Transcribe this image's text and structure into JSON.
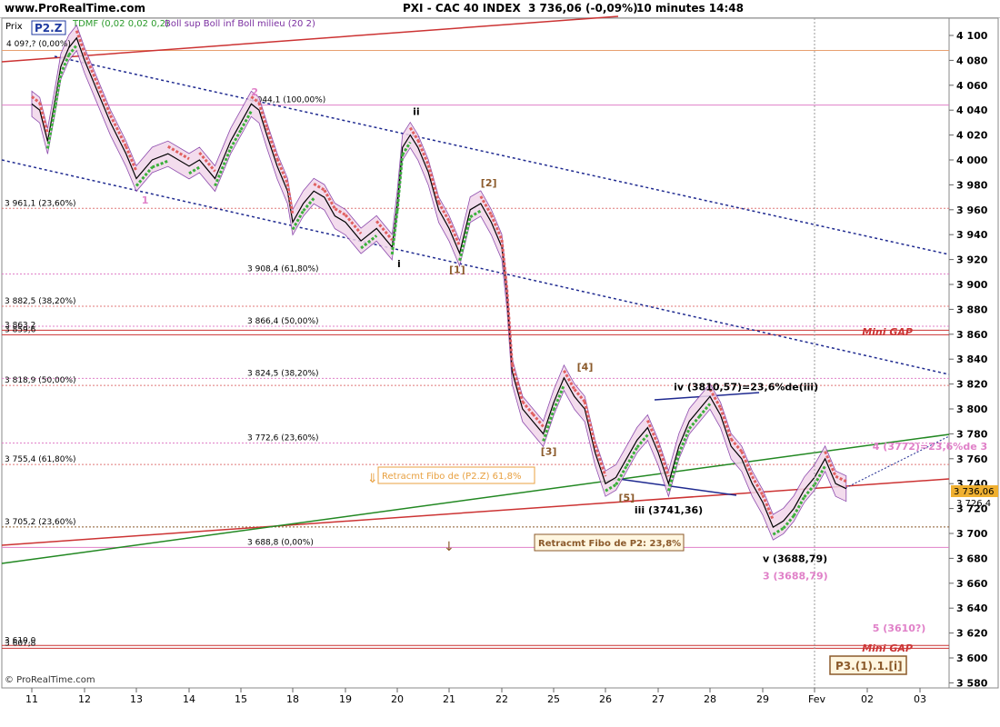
{
  "header": {
    "site": "www.ProRealTime.com",
    "instrument": "PXI - CAC 40 INDEX",
    "last_change": "3 736,06  (-0,09%)",
    "timeframe": "10 minutes  14:48"
  },
  "panel": {
    "prix_label": "Prix",
    "indicators_text": "TDMF (0,02 0,02 0,2)",
    "bollinger_text": "Boll sup Boll inf Boll milieu (20 2)",
    "p2z_box": "P2.Z",
    "copyright": "© ProRealTime.com",
    "last_price_badge": "3 736,06",
    "price_tag_2": "3 726,4",
    "price_tag_1": "3 740,0",
    "wave_label_box": "P3.(1).1.[i]"
  },
  "chart_data": {
    "type": "line",
    "title": "PXI - CAC 40 INDEX",
    "ylim": [
      3570,
      4110
    ],
    "ytick_values": [
      3580,
      3600,
      3620,
      3640,
      3660,
      3680,
      3700,
      3720,
      3740,
      3760,
      3780,
      3800,
      3820,
      3840,
      3860,
      3880,
      3900,
      3920,
      3940,
      3960,
      3980,
      4000,
      4020,
      4040,
      4060,
      4080,
      4100
    ],
    "ytick_labels": [
      "3 580",
      "3 600",
      "3 620",
      "3 640",
      "3 660",
      "3 680",
      "3 700",
      "3 720",
      "3 740",
      "3 760",
      "3 780",
      "3 800",
      "3 820",
      "3 840",
      "3 860",
      "3 880",
      "3 900",
      "3 920",
      "3 940",
      "3 960",
      "3 980",
      "4 000",
      "4 020",
      "4 040",
      "4 060",
      "4 080",
      "4 100"
    ],
    "x_categories": [
      "11",
      "12",
      "13",
      "14",
      "15",
      "18",
      "19",
      "20",
      "21",
      "22",
      "25",
      "26",
      "27",
      "28",
      "29",
      "Fev",
      "02",
      "03"
    ],
    "price_series": {
      "x": [
        0,
        0.15,
        0.3,
        0.45,
        0.55,
        0.7,
        0.85,
        1,
        1.2,
        1.5,
        1.8,
        2,
        2.3,
        2.6,
        3,
        3.2,
        3.5,
        3.8,
        4,
        4.2,
        4.35,
        4.5,
        4.7,
        4.9,
        5,
        5.2,
        5.4,
        5.6,
        5.8,
        6,
        6.3,
        6.6,
        6.9,
        7,
        7.1,
        7.25,
        7.4,
        7.6,
        7.8,
        8,
        8.2,
        8.4,
        8.6,
        8.8,
        9,
        9.1,
        9.2,
        9.3,
        9.4,
        9.6,
        9.8,
        10,
        10.2,
        10.4,
        10.6,
        10.8,
        11,
        11.2,
        11.4,
        11.6,
        11.8,
        12,
        12.2,
        12.4,
        12.6,
        12.8,
        13,
        13.2,
        13.4,
        13.6,
        13.8,
        14,
        14.2,
        14.4,
        14.6,
        14.8,
        15,
        15.2,
        15.4,
        15.6
      ],
      "y": [
        4045,
        4040,
        4015,
        4050,
        4075,
        4090,
        4098,
        4080,
        4060,
        4030,
        4005,
        3985,
        4000,
        4005,
        3995,
        4000,
        3985,
        4015,
        4030,
        4045,
        4040,
        4020,
        3995,
        3975,
        3950,
        3965,
        3975,
        3970,
        3955,
        3950,
        3935,
        3945,
        3930,
        3965,
        4010,
        4020,
        4010,
        3990,
        3960,
        3945,
        3925,
        3960,
        3965,
        3950,
        3930,
        3890,
        3830,
        3815,
        3800,
        3790,
        3780,
        3805,
        3825,
        3810,
        3800,
        3765,
        3740,
        3745,
        3760,
        3775,
        3785,
        3765,
        3740,
        3770,
        3790,
        3800,
        3810,
        3795,
        3770,
        3760,
        3740,
        3725,
        3705,
        3710,
        3720,
        3735,
        3745,
        3760,
        3740,
        3736
      ],
      "name": ""
    },
    "horizontal_levels": [
      {
        "value": 4088,
        "label": "",
        "color": "#e8a070",
        "style": "solid"
      },
      {
        "value": 4044.1,
        "label": "4 044,1 (100,00%)",
        "color": "#e080c8",
        "style": "solid"
      },
      {
        "value": 3961.1,
        "label": "3 961,1 (23,60%)",
        "color": "#e07878",
        "style": "dashed"
      },
      {
        "value": 3908.4,
        "label": "3 908,4 (61,80%)",
        "color": "#e080c8",
        "style": "dashed"
      },
      {
        "value": 3882.5,
        "label": "3 882,5 (38,20%)",
        "color": "#e07878",
        "style": "dashed"
      },
      {
        "value": 3866.4,
        "label": "3 866,4 (50,00%)",
        "color": "#e080c8",
        "style": "dashed"
      },
      {
        "value": 3863.2,
        "label": "3 863,2",
        "color": "#cc3333",
        "style": "solid"
      },
      {
        "value": 3859.6,
        "label": "3 859,6",
        "color": "#cc3333",
        "style": "solid"
      },
      {
        "value": 3824.5,
        "label": "3 824,5 (38,20%)",
        "color": "#e080c8",
        "style": "dashed"
      },
      {
        "value": 3818.9,
        "label": "3 818,9 (50,00%)",
        "color": "#e07878",
        "style": "dashed"
      },
      {
        "value": 3772.6,
        "label": "3 772,6 (23,60%)",
        "color": "#e080c8",
        "style": "dashed"
      },
      {
        "value": 3755.4,
        "label": "3 755,4 (61,80%)",
        "color": "#e07878",
        "style": "dashed"
      },
      {
        "value": 3705.2,
        "label": "3 705,2 (23,60%)",
        "color": "#8b5a2b",
        "style": "dashed"
      },
      {
        "value": 3688.8,
        "label": "3 688,8 (0,00%)",
        "color": "#e080c8",
        "style": "solid"
      },
      {
        "value": 3610.0,
        "label": "3 610,0",
        "color": "#cc3333",
        "style": "solid"
      },
      {
        "value": 3607.8,
        "label": "3 607,8",
        "color": "#cc3333",
        "style": "solid"
      }
    ],
    "top_left_level_label": "4 09?,? (0,00%)",
    "annotations": [
      {
        "text": "2",
        "x": 4.2,
        "y": 4052,
        "color": "#e080c8"
      },
      {
        "text": "1",
        "x": 2.1,
        "y": 3965,
        "color": "#e080c8"
      },
      {
        "text": "ii",
        "x": 7.3,
        "y": 4036,
        "color": "#000000"
      },
      {
        "text": "i",
        "x": 7.0,
        "y": 3914,
        "color": "#000000"
      },
      {
        "text": "[2]",
        "x": 8.6,
        "y": 3979,
        "color": "#8b5a2b"
      },
      {
        "text": "[1]",
        "x": 8.0,
        "y": 3909,
        "color": "#8b5a2b"
      },
      {
        "text": "[4]",
        "x": 10.45,
        "y": 3831,
        "color": "#8b5a2b"
      },
      {
        "text": "[3]",
        "x": 9.75,
        "y": 3763,
        "color": "#8b5a2b"
      },
      {
        "text": "[5]",
        "x": 11.25,
        "y": 3726,
        "color": "#8b5a2b"
      },
      {
        "text": "iv (3810,57)=23,6%de(iii)",
        "x": 12.3,
        "y": 3815,
        "color": "#000000"
      },
      {
        "text": "iii (3741,36)",
        "x": 11.55,
        "y": 3716,
        "color": "#000000"
      },
      {
        "text": "v (3688,79)",
        "x": 14.0,
        "y": 3677,
        "color": "#000000"
      },
      {
        "text": "3 (3688,79)",
        "x": 14.0,
        "y": 3663,
        "color": "#e080c8"
      },
      {
        "text": "4 (3772)=23,6%de 3",
        "x": 16.1,
        "y": 3767,
        "color": "#e080c8"
      },
      {
        "text": "5 (3610?)",
        "x": 16.1,
        "y": 3621,
        "color": "#e080c8"
      },
      {
        "text": "Mini GAP",
        "x": 15.9,
        "y": 3859,
        "color": "#cc3333"
      },
      {
        "text": "Mini GAP",
        "x": 15.9,
        "y": 3605,
        "color": "#cc3333"
      }
    ],
    "fibo_notes": [
      {
        "text": "Retracmt Fibo de (P2.Z) 61,8%",
        "color": "#e8a040"
      },
      {
        "text": "Retracmt Fibo de P2: 23,8%",
        "color": "#8b5a2b"
      }
    ],
    "grid": false,
    "legend": "top-left"
  }
}
